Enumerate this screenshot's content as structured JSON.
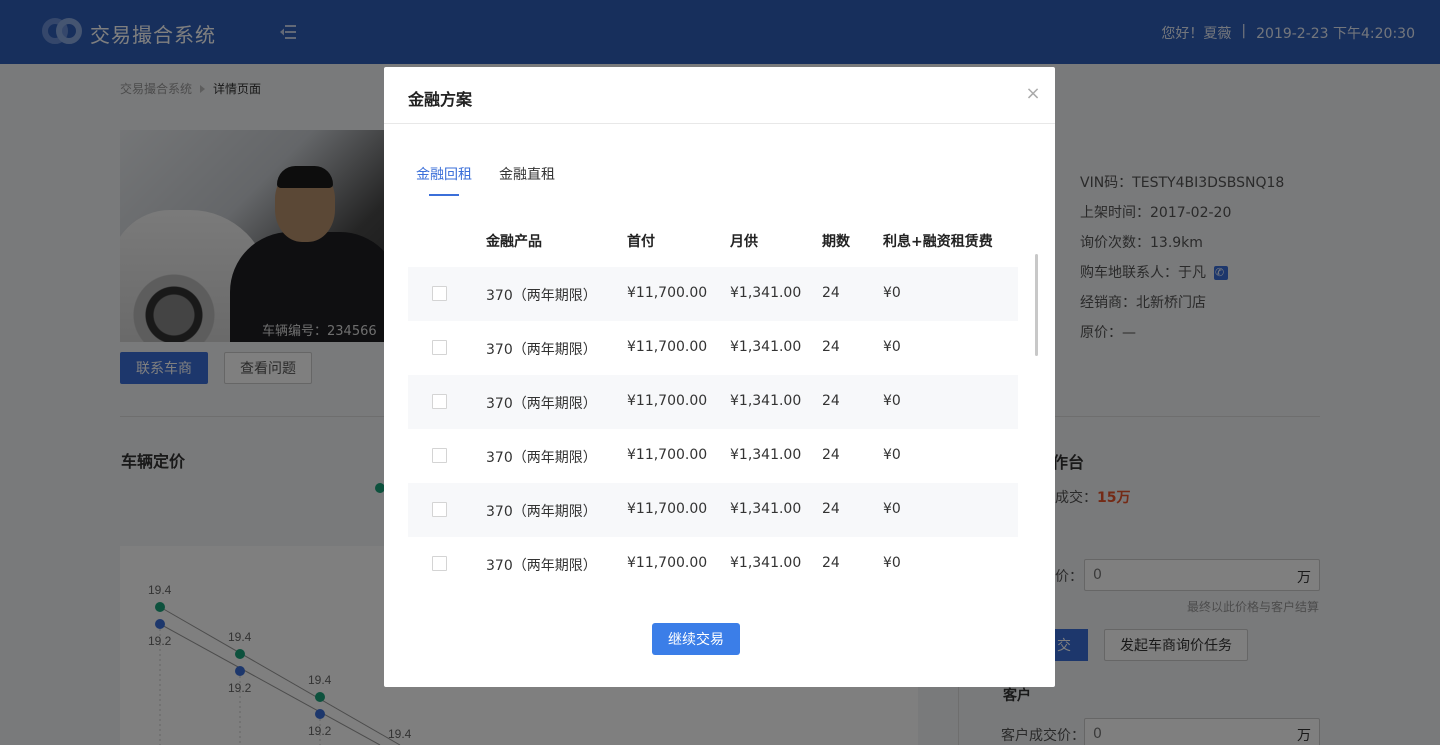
{
  "header": {
    "app_title": "交易撮合系统",
    "greeting": "您好！",
    "user": "夏薇",
    "separator": "|",
    "datetime": "2019-2-23 下午4:20:30"
  },
  "breadcrumb": {
    "root": "交易撮合系统",
    "current": "详情页面"
  },
  "vehicle": {
    "number_label": "车辆编号：234566",
    "contact_button": "联系车商",
    "issue_button": "查看问题",
    "info": [
      "VIN码：TESTY4BI3DSBSNQ18",
      "上架时间：2017-02-20",
      "询价次数：13.9km",
      "购车地联系人：于凡",
      "经销商：北新桥门店",
      "原价：—"
    ]
  },
  "pricing": {
    "title": "车辆定价",
    "point_labels": [
      "19.4",
      "19.2",
      "19.4",
      "19.2",
      "19.4",
      "19.2",
      "19.4"
    ]
  },
  "workspace": {
    "title": "作台",
    "deal_prefix": "成交：",
    "deal_value": "15万",
    "price_label": "价：",
    "price_placeholder": "0",
    "unit": "万",
    "note": "最终以此价格与客户结算",
    "deal_button": "交",
    "task_button": "发起车商询价任务",
    "customer_title": "客户",
    "customer_price_label": "客户成交价：",
    "customer_price_placeholder": "0"
  },
  "modal": {
    "title": "金融方案",
    "close_icon": "close-icon",
    "tabs": [
      "金融回租",
      "金融直租"
    ],
    "active_tab": 0,
    "columns": [
      "金融产品",
      "首付",
      "月供",
      "期数",
      "利息+融资租赁费"
    ],
    "rows": [
      [
        "370（两年期限）",
        "¥11,700.00",
        "¥1,341.00",
        "24",
        "¥0"
      ],
      [
        "370（两年期限）",
        "¥11,700.00",
        "¥1,341.00",
        "24",
        "¥0"
      ],
      [
        "370（两年期限）",
        "¥11,700.00",
        "¥1,341.00",
        "24",
        "¥0"
      ],
      [
        "370（两年期限）",
        "¥11,700.00",
        "¥1,341.00",
        "24",
        "¥0"
      ],
      [
        "370（两年期限）",
        "¥11,700.00",
        "¥1,341.00",
        "24",
        "¥0"
      ],
      [
        "370（两年期限）",
        "¥11,700.00",
        "¥1,341.00",
        "24",
        "¥0"
      ]
    ],
    "continue_button": "继续交易"
  },
  "colors": {
    "primary": "#2f5fb9",
    "accent": "#3b7ee8",
    "highlight": "#e8542b",
    "series_green": "#1aa37a",
    "series_blue": "#3b6fd9"
  }
}
